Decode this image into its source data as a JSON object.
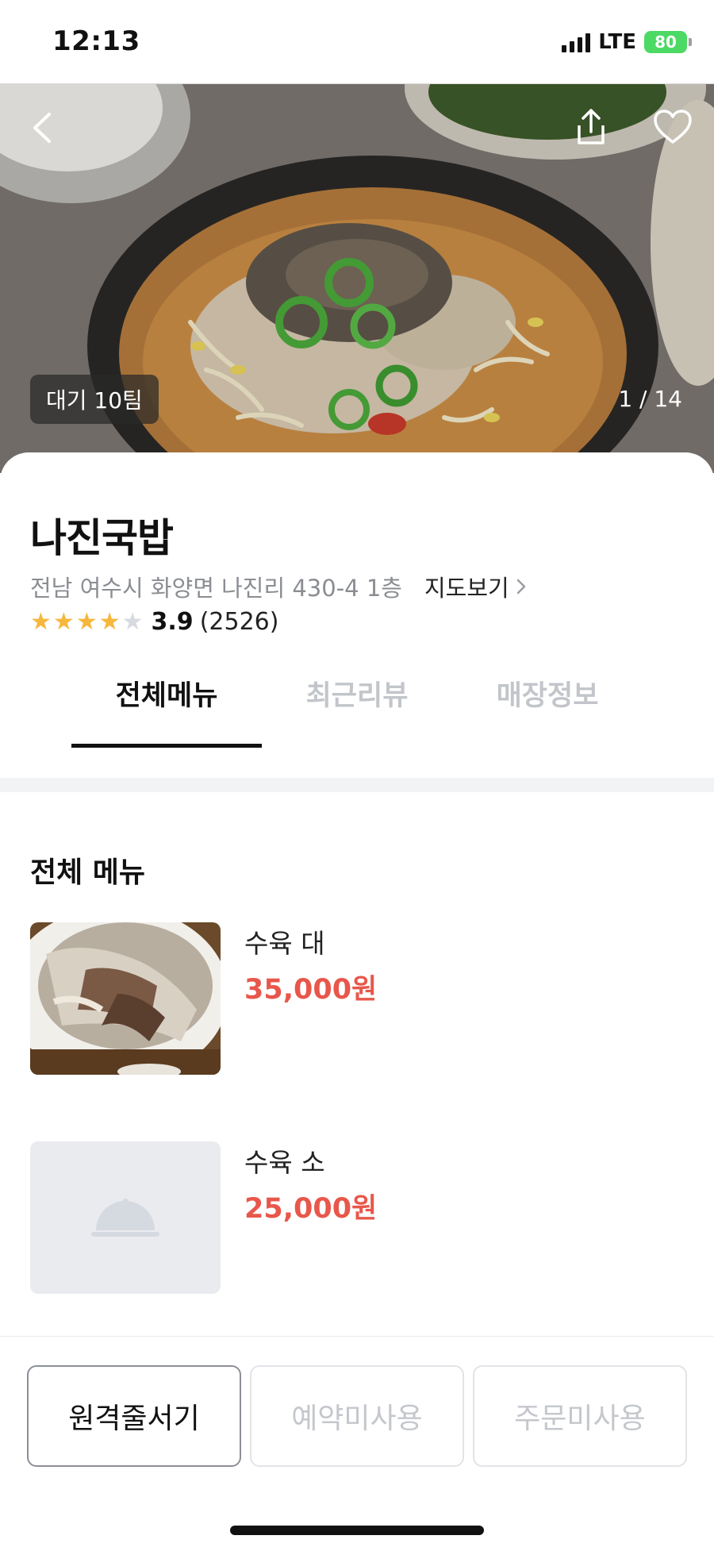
{
  "status_bar": {
    "time": "12:13",
    "network": "LTE",
    "battery": "80"
  },
  "hero": {
    "wait_badge": "대기 10팀",
    "photo_counter": "1 / 14",
    "icons": [
      "back-arrow-icon",
      "share-icon",
      "heart-icon"
    ]
  },
  "store": {
    "name": "나진국밥",
    "address": "전남 여수시 화양면 나진리 430-4 1층",
    "map_link": "지도보기",
    "rating": 3.9,
    "rating_text": "3.9",
    "review_count": "(2526)"
  },
  "tabs": [
    {
      "label": "전체메뉴",
      "active": true
    },
    {
      "label": "최근리뷰",
      "active": false
    },
    {
      "label": "매장정보",
      "active": false
    }
  ],
  "menu": {
    "section_title": "전체 메뉴",
    "items": [
      {
        "name": "수육 대",
        "price": "35,000원",
        "has_photo": true
      },
      {
        "name": "수육 소",
        "price": "25,000원",
        "has_photo": false
      }
    ]
  },
  "actions": {
    "remote_queue": "원격줄서기",
    "reservation": "예약미사용",
    "order": "주문미사용"
  },
  "colors": {
    "price": "#e8574b",
    "star_on": "#f6b73c",
    "star_off": "#d7dae0",
    "battery": "#4cd964"
  }
}
